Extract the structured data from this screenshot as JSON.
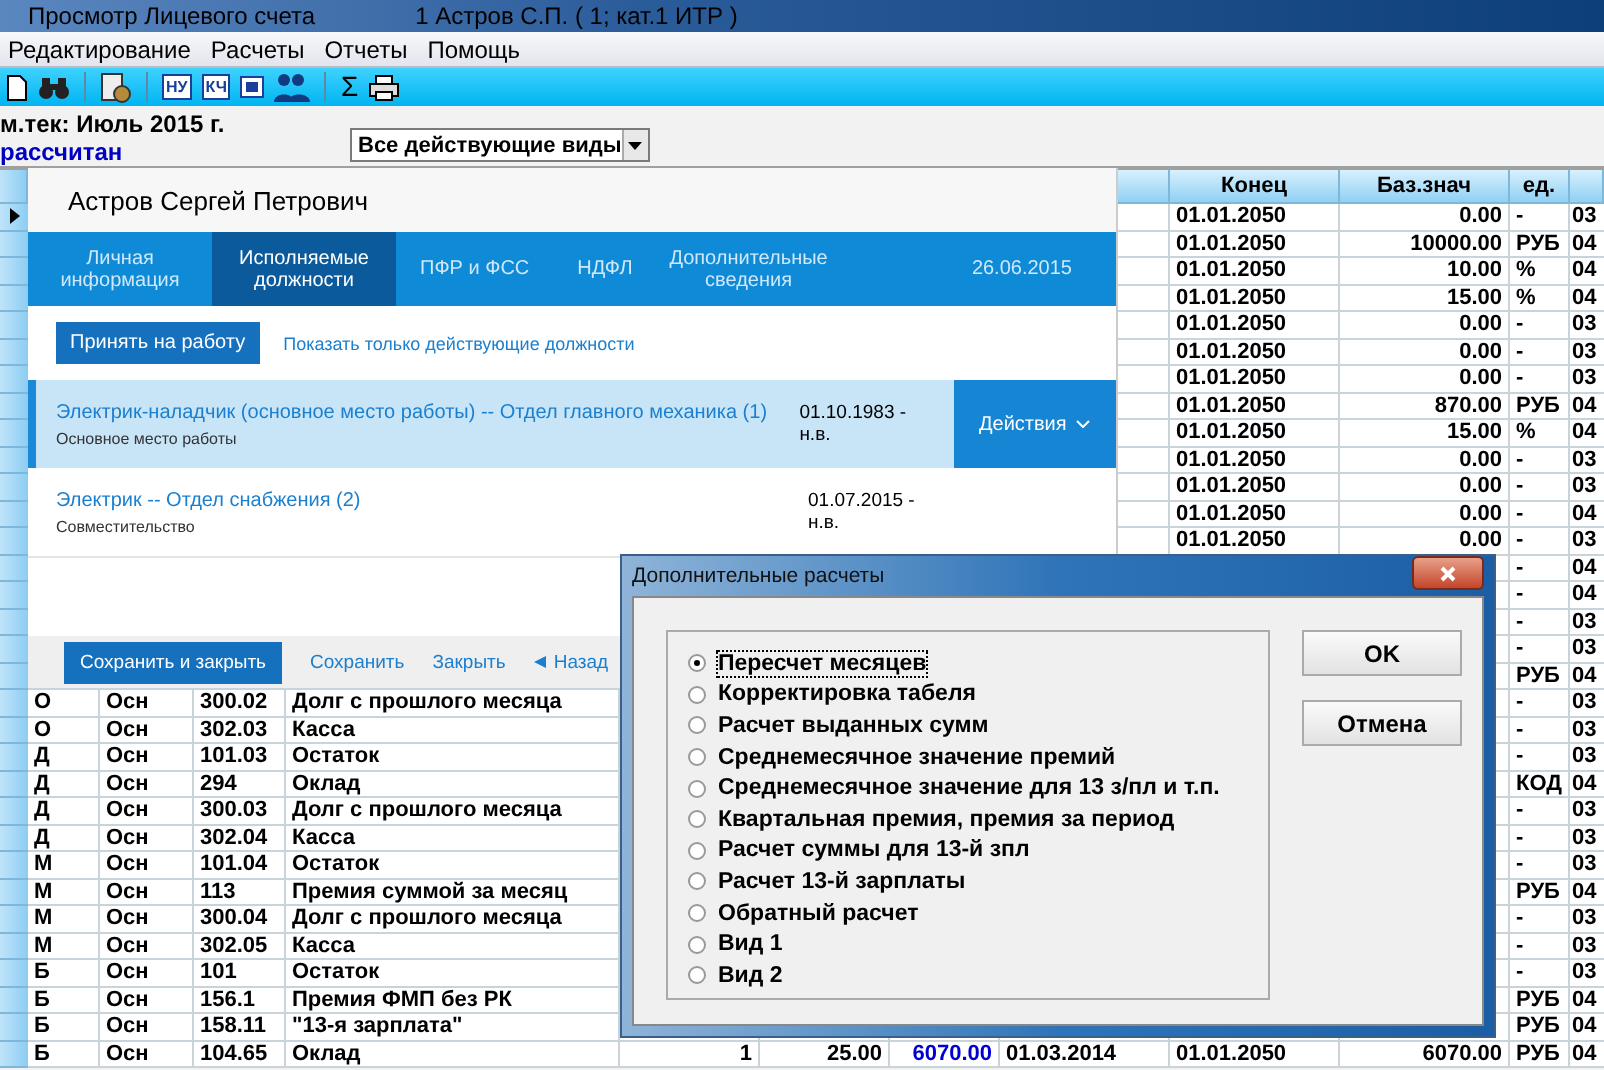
{
  "window": {
    "title": "Просмотр Лицевого счета",
    "subtitle": "1 Астров С.П. ( 1; кат.1 ИТР )"
  },
  "menu": [
    "Редактирование",
    "Расчеты",
    "Отчеты",
    "Помощь"
  ],
  "toolbar": {
    "badge_1": "НУ",
    "badge_2": "КЧ",
    "sum": "Σ"
  },
  "info": {
    "period": "м.тек: Июль 2015 г.",
    "status": "рассчитан",
    "filter": "Все действующие виды"
  },
  "grid": {
    "header": {
      "end": "Конец",
      "base": "Баз.знач",
      "unit": "ед."
    },
    "rows": [
      {
        "selected": true,
        "end": "01.01.2050",
        "base": "0.00",
        "unit": "-",
        "column_12": "03"
      },
      {
        "selected": false,
        "end": "01.01.2050",
        "base": "10000.00",
        "unit": "РУБ",
        "column_12": "04"
      },
      {
        "selected": false,
        "end": "01.01.2050",
        "base": "10.00",
        "unit": "%",
        "column_12": "04"
      },
      {
        "selected": false,
        "end": "01.01.2050",
        "base": "15.00",
        "unit": "%",
        "column_12": "04"
      },
      {
        "selected": false,
        "end": "01.01.2050",
        "base": "0.00",
        "unit": "-",
        "column_12": "03"
      },
      {
        "selected": false,
        "end": "01.01.2050",
        "base": "0.00",
        "unit": "-",
        "column_12": "03"
      },
      {
        "selected": false,
        "end": "01.01.2050",
        "base": "0.00",
        "unit": "-",
        "column_12": "03"
      },
      {
        "selected": false,
        "end": "01.01.2050",
        "base": "870.00",
        "unit": "РУБ",
        "column_12": "04"
      },
      {
        "selected": false,
        "end": "01.01.2050",
        "base": "15.00",
        "unit": "%",
        "column_12": "04"
      },
      {
        "selected": false,
        "end": "01.01.2050",
        "base": "0.00",
        "unit": "-",
        "column_12": "03"
      },
      {
        "selected": false,
        "end": "01.01.2050",
        "base": "0.00",
        "unit": "-",
        "column_12": "03"
      },
      {
        "selected": false,
        "end": "01.01.2050",
        "base": "0.00",
        "unit": "-",
        "column_12": "04"
      },
      {
        "selected": false,
        "end": "01.01.2050",
        "base": "0.00",
        "unit": "-",
        "column_12": "03"
      },
      {
        "selected": false,
        "unit": "-",
        "column_12": "04"
      },
      {
        "selected": false,
        "unit": "-",
        "column_12": "04"
      },
      {
        "selected": false,
        "unit": "-",
        "column_12": "03"
      },
      {
        "selected": false,
        "unit": "-",
        "column_12": "03"
      },
      {
        "selected": false,
        "unit": "РУБ",
        "column_12": "04"
      },
      {
        "selected": false,
        "column_1": "О",
        "column_2": "Осн",
        "column_3": "300.02",
        "column_4": "Долг с прошлого месяца",
        "unit": "-",
        "column_12": "03"
      },
      {
        "selected": false,
        "column_1": "О",
        "column_2": "Осн",
        "column_3": "302.03",
        "column_4": "Касса",
        "unit": "-",
        "column_12": "03"
      },
      {
        "selected": false,
        "column_1": "Д",
        "column_2": "Осн",
        "column_3": "101.03",
        "column_4": "Остаток",
        "unit": "-",
        "column_12": "03"
      },
      {
        "selected": false,
        "column_1": "Д",
        "column_2": "Осн",
        "column_3": "294",
        "column_4": "Оклад",
        "unit": "КОД",
        "column_12": "04"
      },
      {
        "selected": false,
        "column_1": "Д",
        "column_2": "Осн",
        "column_3": "300.03",
        "column_4": "Долг с прошлого месяца",
        "unit": "-",
        "column_12": "03"
      },
      {
        "selected": false,
        "column_1": "Д",
        "column_2": "Осн",
        "column_3": "302.04",
        "column_4": "Касса",
        "unit": "-",
        "column_12": "03"
      },
      {
        "selected": false,
        "column_1": "М",
        "column_2": "Осн",
        "column_3": "101.04",
        "column_4": "Остаток",
        "unit": "-",
        "column_12": "03"
      },
      {
        "selected": false,
        "column_1": "М",
        "column_2": "Осн",
        "column_3": "113",
        "column_4": "Премия суммой за месяц",
        "unit": "РУБ",
        "column_12": "04"
      },
      {
        "selected": false,
        "column_1": "М",
        "column_2": "Осн",
        "column_3": "300.04",
        "column_4": "Долг с прошлого месяца",
        "unit": "-",
        "column_12": "03"
      },
      {
        "selected": false,
        "column_1": "М",
        "column_2": "Осн",
        "column_3": "302.05",
        "column_4": "Касса",
        "unit": "-",
        "column_12": "03"
      },
      {
        "selected": false,
        "column_1": "Б",
        "column_2": "Осн",
        "column_3": "101",
        "column_4": "Остаток",
        "unit": "-",
        "column_12": "03"
      },
      {
        "selected": false,
        "column_1": "Б",
        "column_2": "Осн",
        "column_3": "156.1",
        "column_4": "Премия ФМП без РК",
        "unit": "РУБ",
        "column_12": "04"
      },
      {
        "selected": false,
        "column_1": "Б",
        "column_2": "Осн",
        "column_3": "158.11",
        "column_4": "\"13-я зарплата\"",
        "unit": "РУБ",
        "column_12": "04"
      },
      {
        "selected": false,
        "column_1": "Б",
        "column_2": "Осн",
        "column_3": "104.65",
        "column_4": "Оклад",
        "column_5": "1",
        "column_6": "25.00",
        "column_7": "6070.00",
        "column_8": "01.03.2014",
        "end": "01.01.2050",
        "base": "6070.00",
        "unit": "РУБ",
        "column_12": "04"
      }
    ]
  },
  "employee_card": {
    "name": "Астров Сергей Петрович",
    "tabs": [
      {
        "label": "Личная информация",
        "selected": false
      },
      {
        "label": "Исполняемые должности",
        "selected": true
      },
      {
        "label": "ПФР и ФСС",
        "selected": false
      },
      {
        "label": "НДФЛ",
        "selected": false
      },
      {
        "label": "Дополнительные сведения",
        "selected": false
      }
    ],
    "date": "26.06.2015",
    "hire_button": "Принять на работу",
    "filter_link": "Показать только действующие должности",
    "positions": [
      {
        "title": "Электрик-наладчик (основное место работы) -- Отдел главного механика (1)",
        "type": "Основное место работы",
        "period_start": "01.10.1983 -",
        "period_end": "н.в.",
        "selected": true,
        "actions": "Действия"
      },
      {
        "title": "Электрик -- Отдел снабжения (2)",
        "type": "Совместительство",
        "period_start": "01.07.2015 -",
        "period_end": "н.в.",
        "selected": false
      }
    ],
    "footer": {
      "save_close": "Сохранить и закрыть",
      "save": "Сохранить",
      "close": "Закрыть",
      "back": "Назад"
    }
  },
  "dialog": {
    "title": "Дополнительные расчеты",
    "options": [
      {
        "label": "Пересчет месяцев",
        "selected": true
      },
      {
        "label": "Корректировка табеля",
        "selected": false
      },
      {
        "label": "Расчет выданных сумм",
        "selected": false
      },
      {
        "label": "Среднемесячное значение премий",
        "selected": false
      },
      {
        "label": "Среднемесячное значение для 13 з/пл и т.п.",
        "selected": false
      },
      {
        "label": "Квартальная премия, премия за период",
        "selected": false
      },
      {
        "label": "Расчет суммы для 13-й зпл",
        "selected": false
      },
      {
        "label": "Расчет 13-й зарплаты",
        "selected": false
      },
      {
        "label": "Обратный расчет",
        "selected": false
      },
      {
        "label": "Вид 1",
        "selected": false
      },
      {
        "label": "Вид 2",
        "selected": false
      }
    ],
    "ok": "OK",
    "cancel": "Отмена"
  }
}
